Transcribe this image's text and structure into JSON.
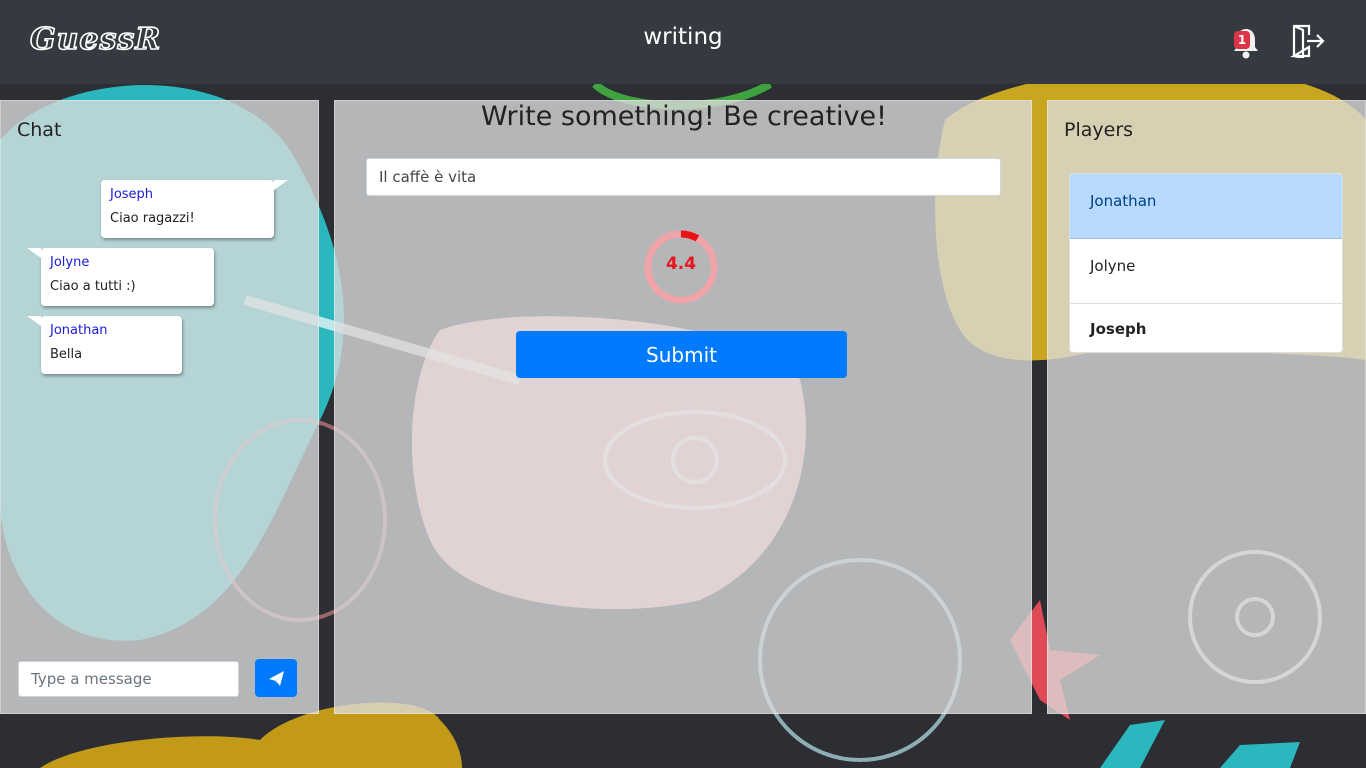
{
  "navbar": {
    "logo": "GuessR",
    "status": "writing",
    "notification_count": "1"
  },
  "chat": {
    "title": "Chat",
    "messages": [
      {
        "sender": "Joseph",
        "text": "Ciao ragazzi!"
      },
      {
        "sender": "Jolyne",
        "text": "Ciao a tutti :)"
      },
      {
        "sender": "Jonathan",
        "text": "Bella"
      }
    ],
    "input_placeholder": "Type a message"
  },
  "game": {
    "prompt": "Write something! Be creative!",
    "input_value": "Il caffè è vita",
    "timer_value": "4.4",
    "submit_label": "Submit"
  },
  "players": {
    "title": "Players",
    "list": [
      {
        "name": "Jonathan"
      },
      {
        "name": "Jolyne"
      },
      {
        "name": "Joseph"
      }
    ]
  },
  "colors": {
    "accent": "#007bff",
    "navbar": "#343a40",
    "badge": "#dc3545",
    "timer": "#e8141e",
    "active_player": "#b8daff"
  },
  "icons": {
    "bell": "bell-icon",
    "logout": "logout-icon",
    "send": "paper-plane-icon"
  }
}
